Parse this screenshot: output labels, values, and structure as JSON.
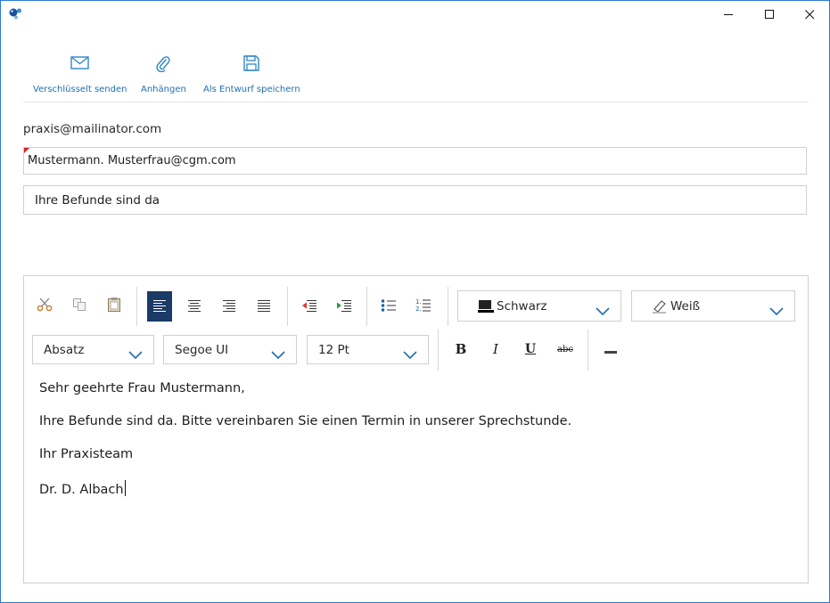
{
  "window": {
    "buttons": {
      "minimize": "minimize",
      "maximize": "maximize",
      "close": "close"
    }
  },
  "toolbar": {
    "send_encrypted_label": "Verschlüsselt senden",
    "attach_label": "Anhängen",
    "save_draft_label": "Als Entwurf speichern"
  },
  "from": "praxis@mailinator.com",
  "to": "Mustermann. Musterfrau@cgm.com",
  "subject": "Ihre Befunde sind da",
  "editor": {
    "text_color": {
      "label": "Schwarz",
      "color": "#000000"
    },
    "highlight_color": {
      "label": "Weiß",
      "color": "#ffffff"
    },
    "paragraph_style": "Absatz",
    "font_name": "Segoe UI",
    "font_size": "12 Pt",
    "bold_label": "B",
    "italic_label": "I",
    "underline_label": "U",
    "strikethrough_label": "abc",
    "active_alignment": "left",
    "body_lines": [
      "Sehr geehrte Frau Mustermann,",
      "Ihre Befunde sind da. Bitte vereinbaren Sie einen Termin in unserer Sprechstunde.",
      "Ihr Praxisteam",
      "Dr. D. Albach"
    ]
  },
  "colors": {
    "window_border": "#2b7bd1",
    "accent": "#1f6fb3",
    "active_button": "#1b3a66",
    "required_marker": "#e02020"
  }
}
